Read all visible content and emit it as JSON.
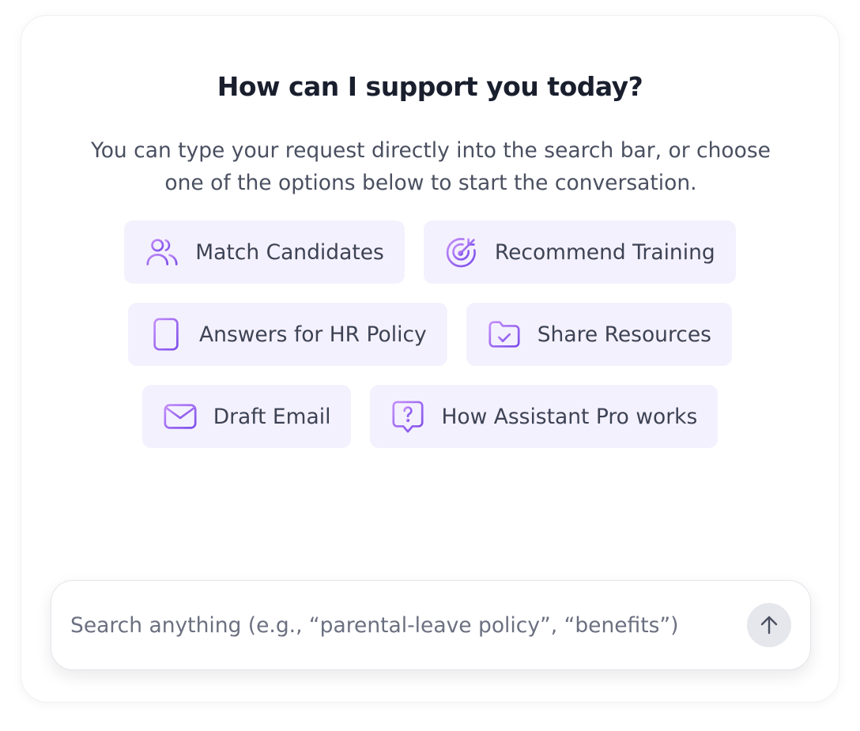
{
  "header": {
    "title": "How can I support you today?",
    "subtitle": "You can type your request directly into the search bar, or choose one of the options below to start the conversation."
  },
  "options": [
    {
      "label": "Match Candidates",
      "icon": "users-icon"
    },
    {
      "label": "Recommend Training",
      "icon": "target-icon"
    },
    {
      "label": "Answers for HR Policy",
      "icon": "document-icon"
    },
    {
      "label": "Share Resources",
      "icon": "folder-check-icon"
    },
    {
      "label": "Draft Email",
      "icon": "mail-icon"
    },
    {
      "label": "How Assistant Pro works",
      "icon": "question-bubble-icon"
    }
  ],
  "search": {
    "placeholder": "Search anything (e.g., “parental-leave policy”, “benefits”)",
    "value": "",
    "send_icon": "arrow-up-icon"
  },
  "colors": {
    "accent": "#8b5cf6",
    "accent_light": "#c084fc",
    "chip_background": "#f4f1fe",
    "title_text": "#1a1f2e",
    "body_text": "#4a5061",
    "send_button": "#e5e7ec"
  }
}
